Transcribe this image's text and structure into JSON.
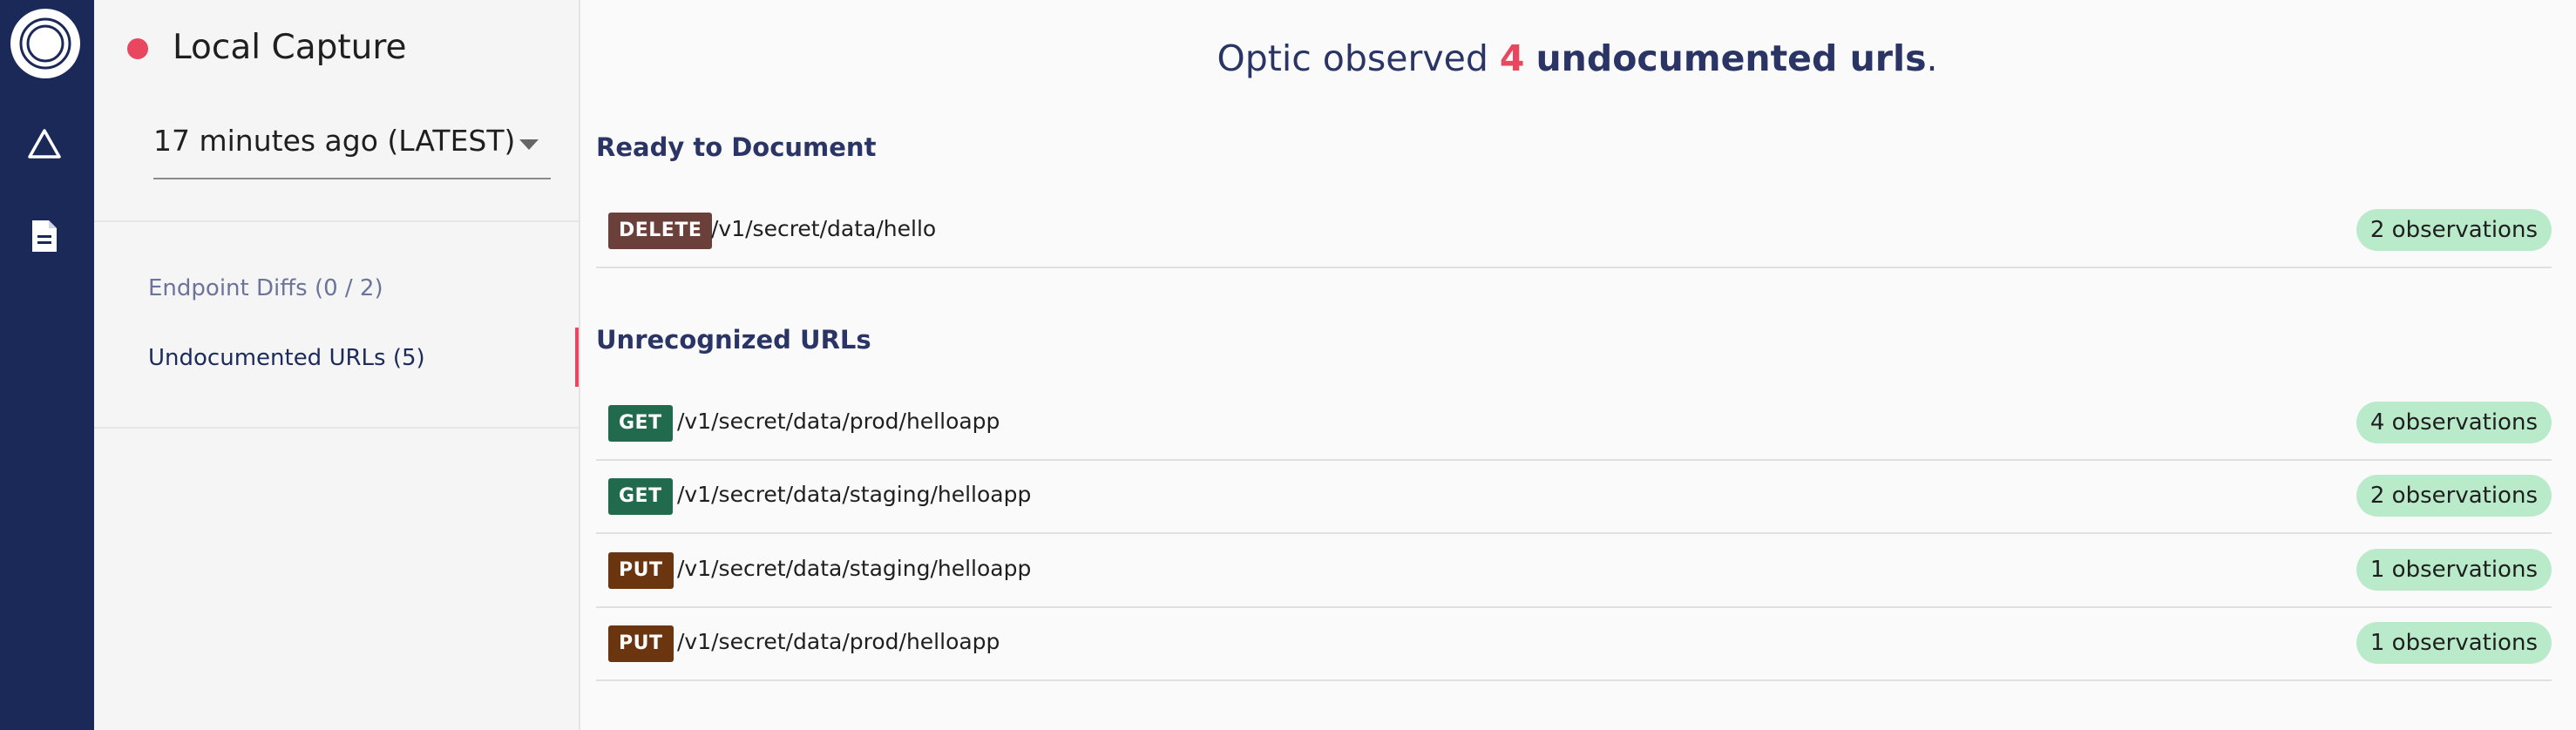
{
  "rail": {
    "logo_icon": "optic-logo-icon",
    "items": [
      {
        "icon": "diff-triangle-icon"
      },
      {
        "icon": "document-icon"
      }
    ],
    "background": "#1b2958"
  },
  "capture": {
    "title": "Local Capture",
    "selected": "17 minutes ago (LATEST)",
    "status_color": "#e8475f"
  },
  "sidebar_nav": {
    "endpoint_diffs": "Endpoint Diffs (0 / 2)",
    "undocumented_urls": "Undocumented URLs (5)"
  },
  "headline": {
    "prefix": "Optic observed",
    "count": "4",
    "strong": "undocumented urls",
    "suffix": "."
  },
  "ready": {
    "title": "Ready to Document",
    "rows": [
      {
        "method": "DELETE",
        "path": "/v1/secret/data/hello",
        "observations": "2 observations",
        "method_color": "#6b3f3a"
      }
    ]
  },
  "unrecognized": {
    "title": "Unrecognized URLs",
    "rows": [
      {
        "method": "GET",
        "path": "/v1/secret/data/prod/helloapp",
        "observations": "4 observations",
        "method_color": "#226a4d"
      },
      {
        "method": "GET",
        "path": "/v1/secret/data/staging/helloapp",
        "observations": "2 observations",
        "method_color": "#226a4d"
      },
      {
        "method": "PUT",
        "path": "/v1/secret/data/staging/helloapp",
        "observations": "1 observations",
        "method_color": "#6b3510"
      },
      {
        "method": "PUT",
        "path": "/v1/secret/data/prod/helloapp",
        "observations": "1 observations",
        "method_color": "#6b3510"
      }
    ]
  },
  "colors": {
    "accent": "#e8475f",
    "observation_badge": "#b9ebcb"
  }
}
